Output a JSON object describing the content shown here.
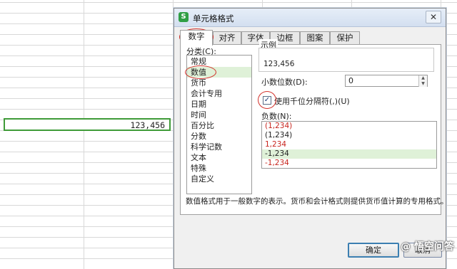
{
  "sheet": {
    "active_cell_value": "123,456"
  },
  "dialog": {
    "title": "单元格格式",
    "app_icon_letter": "S",
    "close_glyph": "✕",
    "tabs": [
      {
        "label": "数字",
        "active": true
      },
      {
        "label": "对齐"
      },
      {
        "label": "字体"
      },
      {
        "label": "边框"
      },
      {
        "label": "图案"
      },
      {
        "label": "保护"
      }
    ],
    "category_label": "分类(C):",
    "categories": [
      "常规",
      "数值",
      "货币",
      "会计专用",
      "日期",
      "时间",
      "百分比",
      "分数",
      "科学记数",
      "文本",
      "特殊",
      "自定义"
    ],
    "selected_category": "数值",
    "sample_label": "示例",
    "sample_value": "123,456",
    "decimal_label": "小数位数(D):",
    "decimal_value": "0",
    "thousands_label": "使用千位分隔符(,)(U)",
    "thousands_checked": true,
    "negative_label": "负数(N):",
    "negative_options": [
      {
        "text": "(1,234)",
        "red": true
      },
      {
        "text": "(1,234)",
        "red": false
      },
      {
        "text": "1,234",
        "red": true
      },
      {
        "text": "-1,234",
        "red": false,
        "selected": true
      },
      {
        "text": "-1,234",
        "red": true
      }
    ],
    "description": "数值格式用于一般数字的表示。货币和会计格式则提供货币值计算的专用格式。",
    "ok_label": "确定",
    "cancel_label": "取消"
  },
  "watermark": "@ 悟空问答",
  "colors": {
    "accent_green": "#3f9b38",
    "highlight_red": "#d2302a",
    "selection_bg": "#dff1d8"
  }
}
